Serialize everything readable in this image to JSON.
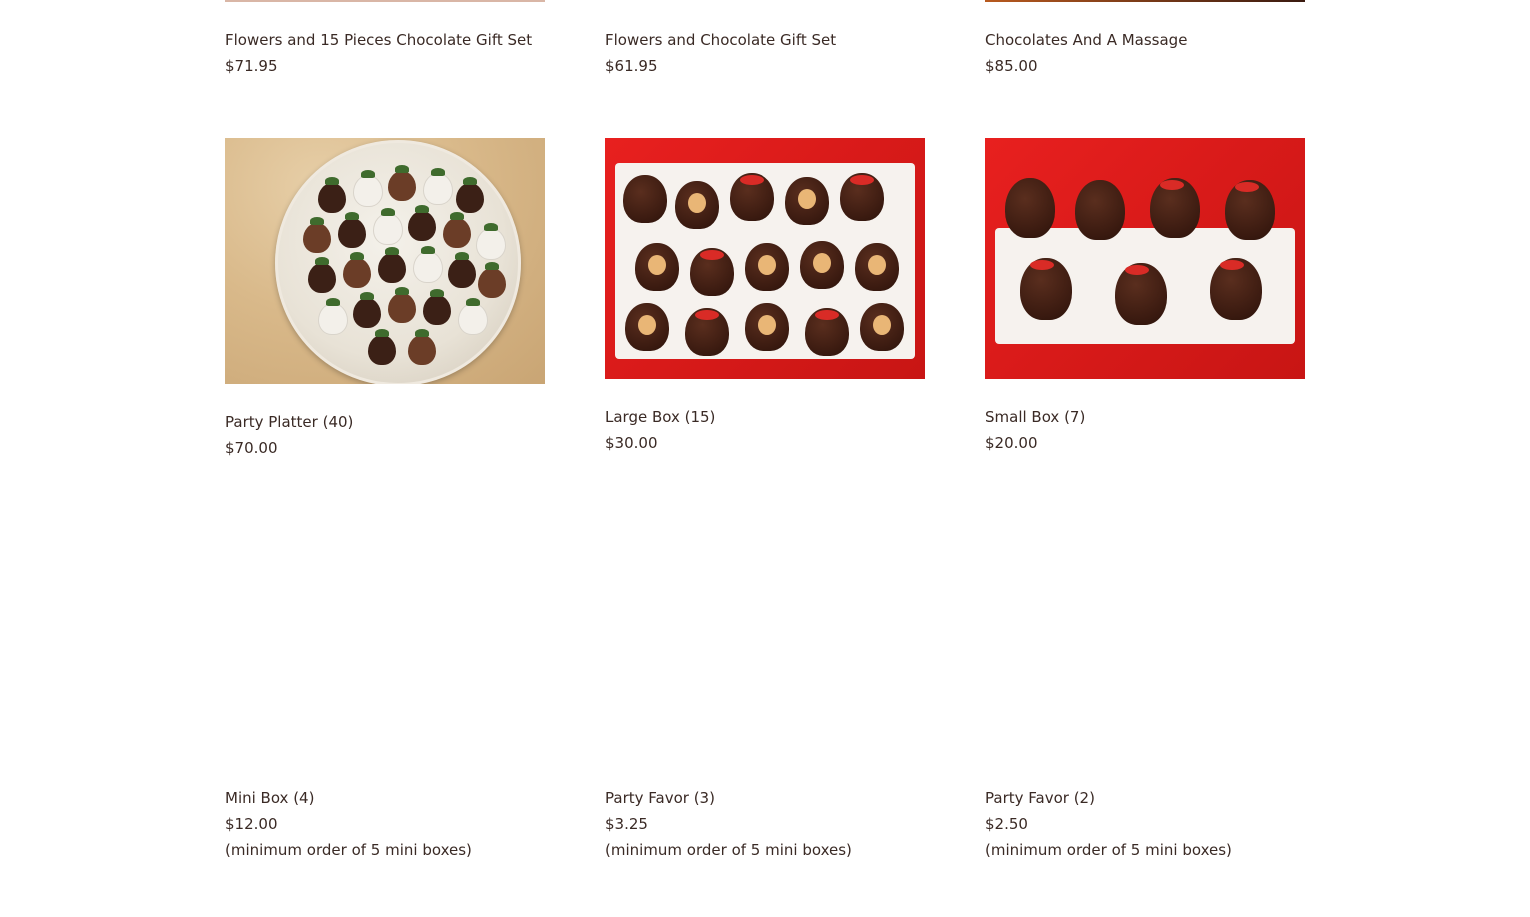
{
  "products": [
    {
      "name": "Flowers and 15 Pieces Chocolate Gift Set",
      "price": "$71.95",
      "note": ""
    },
    {
      "name": "Flowers and Chocolate Gift Set",
      "price": "$61.95",
      "note": ""
    },
    {
      "name": "Chocolates And A Massage",
      "price": "$85.00",
      "note": ""
    },
    {
      "name": "Party Platter (40)",
      "price": "$70.00",
      "note": ""
    },
    {
      "name": "Large Box (15)",
      "price": "$30.00",
      "note": ""
    },
    {
      "name": "Small Box (7)",
      "price": "$20.00",
      "note": ""
    },
    {
      "name": "Mini Box (4)",
      "price": "$12.00",
      "note": "(minimum order of 5 mini boxes)"
    },
    {
      "name": "Party Favor (3)",
      "price": "$3.25",
      "note": "(minimum order of 5 mini boxes)"
    },
    {
      "name": "Party Favor (2)",
      "price": "$2.50",
      "note": "(minimum order of 5 mini boxes)"
    }
  ],
  "colors": {
    "text": "#3a2a25",
    "box_red": "#d81a19",
    "chocolate": "#3a1a10"
  }
}
